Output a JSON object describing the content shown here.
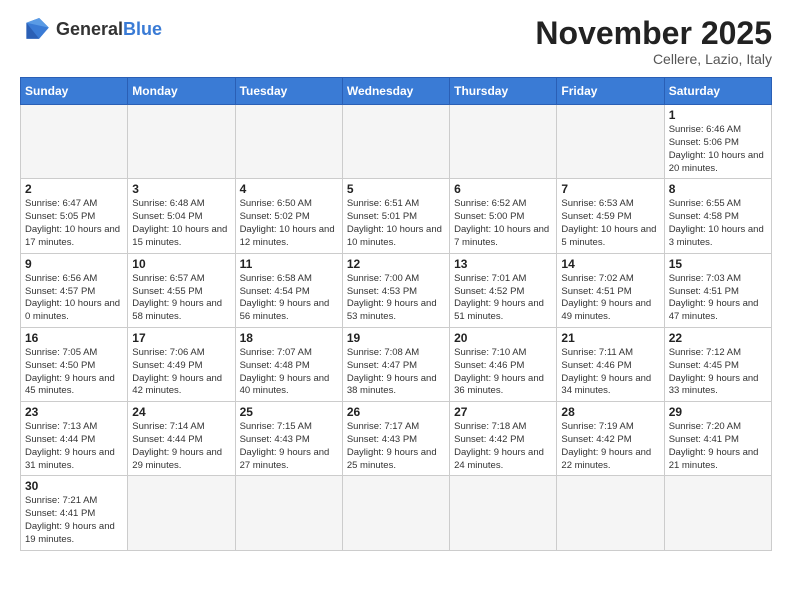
{
  "header": {
    "logo_general": "General",
    "logo_blue": "Blue",
    "month_title": "November 2025",
    "location": "Cellere, Lazio, Italy"
  },
  "days_of_week": [
    "Sunday",
    "Monday",
    "Tuesday",
    "Wednesday",
    "Thursday",
    "Friday",
    "Saturday"
  ],
  "weeks": [
    [
      {
        "day": "",
        "info": ""
      },
      {
        "day": "",
        "info": ""
      },
      {
        "day": "",
        "info": ""
      },
      {
        "day": "",
        "info": ""
      },
      {
        "day": "",
        "info": ""
      },
      {
        "day": "",
        "info": ""
      },
      {
        "day": "1",
        "info": "Sunrise: 6:46 AM\nSunset: 5:06 PM\nDaylight: 10 hours and 20 minutes."
      }
    ],
    [
      {
        "day": "2",
        "info": "Sunrise: 6:47 AM\nSunset: 5:05 PM\nDaylight: 10 hours and 17 minutes."
      },
      {
        "day": "3",
        "info": "Sunrise: 6:48 AM\nSunset: 5:04 PM\nDaylight: 10 hours and 15 minutes."
      },
      {
        "day": "4",
        "info": "Sunrise: 6:50 AM\nSunset: 5:02 PM\nDaylight: 10 hours and 12 minutes."
      },
      {
        "day": "5",
        "info": "Sunrise: 6:51 AM\nSunset: 5:01 PM\nDaylight: 10 hours and 10 minutes."
      },
      {
        "day": "6",
        "info": "Sunrise: 6:52 AM\nSunset: 5:00 PM\nDaylight: 10 hours and 7 minutes."
      },
      {
        "day": "7",
        "info": "Sunrise: 6:53 AM\nSunset: 4:59 PM\nDaylight: 10 hours and 5 minutes."
      },
      {
        "day": "8",
        "info": "Sunrise: 6:55 AM\nSunset: 4:58 PM\nDaylight: 10 hours and 3 minutes."
      }
    ],
    [
      {
        "day": "9",
        "info": "Sunrise: 6:56 AM\nSunset: 4:57 PM\nDaylight: 10 hours and 0 minutes."
      },
      {
        "day": "10",
        "info": "Sunrise: 6:57 AM\nSunset: 4:55 PM\nDaylight: 9 hours and 58 minutes."
      },
      {
        "day": "11",
        "info": "Sunrise: 6:58 AM\nSunset: 4:54 PM\nDaylight: 9 hours and 56 minutes."
      },
      {
        "day": "12",
        "info": "Sunrise: 7:00 AM\nSunset: 4:53 PM\nDaylight: 9 hours and 53 minutes."
      },
      {
        "day": "13",
        "info": "Sunrise: 7:01 AM\nSunset: 4:52 PM\nDaylight: 9 hours and 51 minutes."
      },
      {
        "day": "14",
        "info": "Sunrise: 7:02 AM\nSunset: 4:51 PM\nDaylight: 9 hours and 49 minutes."
      },
      {
        "day": "15",
        "info": "Sunrise: 7:03 AM\nSunset: 4:51 PM\nDaylight: 9 hours and 47 minutes."
      }
    ],
    [
      {
        "day": "16",
        "info": "Sunrise: 7:05 AM\nSunset: 4:50 PM\nDaylight: 9 hours and 45 minutes."
      },
      {
        "day": "17",
        "info": "Sunrise: 7:06 AM\nSunset: 4:49 PM\nDaylight: 9 hours and 42 minutes."
      },
      {
        "day": "18",
        "info": "Sunrise: 7:07 AM\nSunset: 4:48 PM\nDaylight: 9 hours and 40 minutes."
      },
      {
        "day": "19",
        "info": "Sunrise: 7:08 AM\nSunset: 4:47 PM\nDaylight: 9 hours and 38 minutes."
      },
      {
        "day": "20",
        "info": "Sunrise: 7:10 AM\nSunset: 4:46 PM\nDaylight: 9 hours and 36 minutes."
      },
      {
        "day": "21",
        "info": "Sunrise: 7:11 AM\nSunset: 4:46 PM\nDaylight: 9 hours and 34 minutes."
      },
      {
        "day": "22",
        "info": "Sunrise: 7:12 AM\nSunset: 4:45 PM\nDaylight: 9 hours and 33 minutes."
      }
    ],
    [
      {
        "day": "23",
        "info": "Sunrise: 7:13 AM\nSunset: 4:44 PM\nDaylight: 9 hours and 31 minutes."
      },
      {
        "day": "24",
        "info": "Sunrise: 7:14 AM\nSunset: 4:44 PM\nDaylight: 9 hours and 29 minutes."
      },
      {
        "day": "25",
        "info": "Sunrise: 7:15 AM\nSunset: 4:43 PM\nDaylight: 9 hours and 27 minutes."
      },
      {
        "day": "26",
        "info": "Sunrise: 7:17 AM\nSunset: 4:43 PM\nDaylight: 9 hours and 25 minutes."
      },
      {
        "day": "27",
        "info": "Sunrise: 7:18 AM\nSunset: 4:42 PM\nDaylight: 9 hours and 24 minutes."
      },
      {
        "day": "28",
        "info": "Sunrise: 7:19 AM\nSunset: 4:42 PM\nDaylight: 9 hours and 22 minutes."
      },
      {
        "day": "29",
        "info": "Sunrise: 7:20 AM\nSunset: 4:41 PM\nDaylight: 9 hours and 21 minutes."
      }
    ],
    [
      {
        "day": "30",
        "info": "Sunrise: 7:21 AM\nSunset: 4:41 PM\nDaylight: 9 hours and 19 minutes."
      },
      {
        "day": "",
        "info": ""
      },
      {
        "day": "",
        "info": ""
      },
      {
        "day": "",
        "info": ""
      },
      {
        "day": "",
        "info": ""
      },
      {
        "day": "",
        "info": ""
      },
      {
        "day": "",
        "info": ""
      }
    ]
  ]
}
